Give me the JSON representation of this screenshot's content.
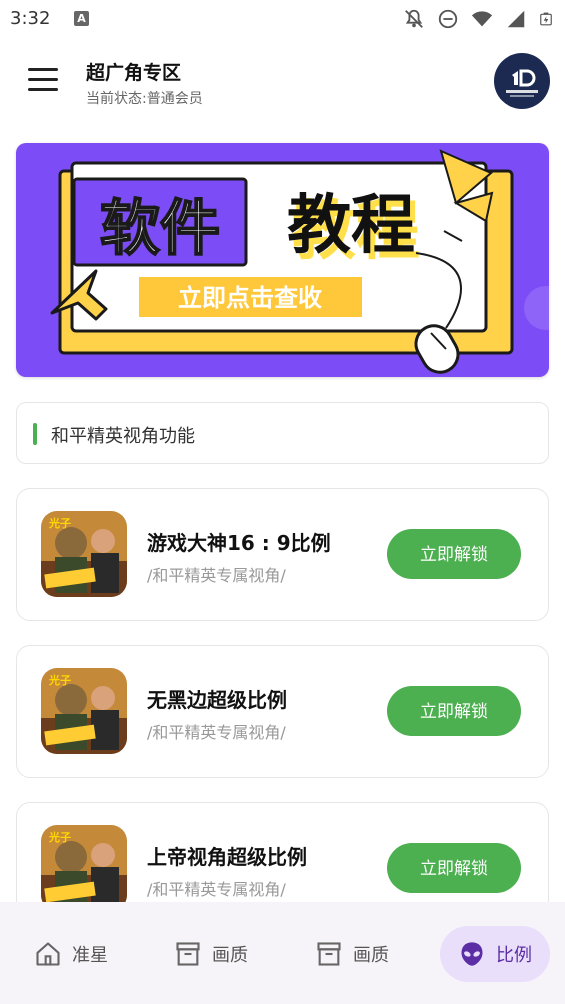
{
  "status_bar": {
    "time": "3:32",
    "notification_glyph": "A",
    "icons": [
      "notifications-off-icon",
      "dnd-icon",
      "wifi-icon",
      "signal-icon",
      "battery-icon"
    ]
  },
  "header": {
    "title": "超广角专区",
    "subtitle": "当前状态:普通会员"
  },
  "banner": {
    "word_left": "软件",
    "word_right": "教程",
    "cta": "立即点击查收"
  },
  "section": {
    "label": "和平精英视角功能",
    "accent_color": "#4caf50"
  },
  "items": [
    {
      "name": "游戏大神16 : 9比例",
      "desc": "/和平精英专属视角/",
      "button": "立即解锁"
    },
    {
      "name": "无黑边超级比例",
      "desc": "/和平精英专属视角/",
      "button": "立即解锁"
    },
    {
      "name": "上帝视角超级比例",
      "desc": "/和平精英专属视角/",
      "button": "立即解锁"
    }
  ],
  "nav": [
    {
      "label": "准星",
      "icon": "home-icon",
      "active": false
    },
    {
      "label": "画质",
      "icon": "archive-icon",
      "active": false
    },
    {
      "label": "画质",
      "icon": "archive-icon",
      "active": false
    },
    {
      "label": "比例",
      "icon": "alien-icon",
      "active": true
    }
  ],
  "colors": {
    "accent_green": "#4caf50",
    "banner_purple": "#7c4df6",
    "nav_active_bg": "#e9dffb"
  }
}
